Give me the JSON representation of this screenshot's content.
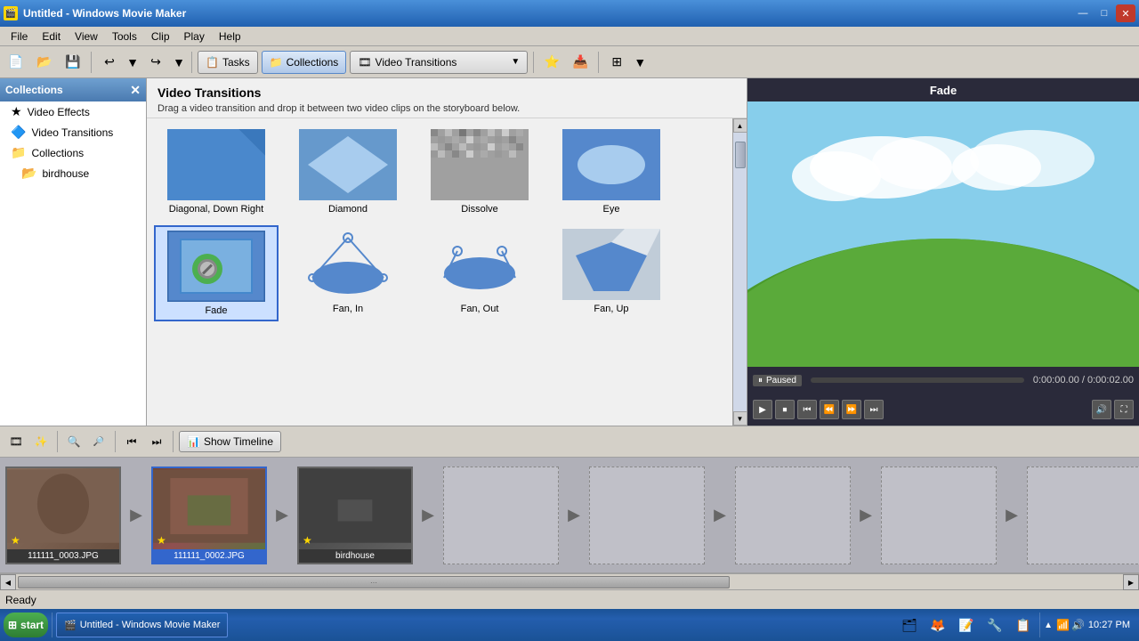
{
  "window": {
    "title": "Untitled - Windows Movie Maker",
    "icon": "🎬"
  },
  "titlebar": {
    "minimize": "—",
    "maximize": "□",
    "close": "✕"
  },
  "menu": {
    "items": [
      "File",
      "Edit",
      "View",
      "Tools",
      "Clip",
      "Play",
      "Help"
    ]
  },
  "toolbar": {
    "tasks_label": "Tasks",
    "collections_label": "Collections",
    "dropdown_label": "Video Transitions",
    "dropdown_icon": "🎞"
  },
  "left_panel": {
    "header": "Collections",
    "items": [
      {
        "label": "Video Effects",
        "icon": "★"
      },
      {
        "label": "Video Transitions",
        "icon": "🔄"
      },
      {
        "label": "Collections",
        "icon": "📁"
      },
      {
        "label": "birdhouse",
        "icon": "📂",
        "sub": true
      }
    ]
  },
  "transitions_panel": {
    "title": "Video Transitions",
    "description": "Drag a video transition and drop it between two video clips on the storyboard below.",
    "items": [
      {
        "name": "Diagonal, Down Right",
        "type": "diagonal-down-right"
      },
      {
        "name": "Diamond",
        "type": "diamond"
      },
      {
        "name": "Dissolve",
        "type": "dissolve"
      },
      {
        "name": "Eye",
        "type": "eye"
      },
      {
        "name": "Fade",
        "type": "fade",
        "selected": true
      },
      {
        "name": "Fan, In",
        "type": "fan-in"
      },
      {
        "name": "Fan, Out",
        "type": "fan-out"
      },
      {
        "name": "Fan, Up",
        "type": "fan-up"
      }
    ]
  },
  "preview": {
    "title": "Fade",
    "status": "Paused",
    "time": "0:00:00.00 / 0:00:02.00"
  },
  "bottom_toolbar": {
    "show_timeline_label": "Show Timeline"
  },
  "storyboard": {
    "clips": [
      {
        "label": "111111_0003.JPG",
        "selected": false,
        "type": "clip1"
      },
      {
        "label": "111111_0002.JPG",
        "selected": true,
        "type": "clip2"
      },
      {
        "label": "birdhouse",
        "selected": false,
        "type": "clip3"
      }
    ]
  },
  "status_bar": {
    "text": "Ready"
  },
  "taskbar": {
    "start_label": "start",
    "app_label": "Untitled - Windows Movie Maker",
    "time": "10:27 PM",
    "icons": [
      "🗂",
      "🦊",
      "📝",
      "🔧",
      "📋"
    ]
  }
}
